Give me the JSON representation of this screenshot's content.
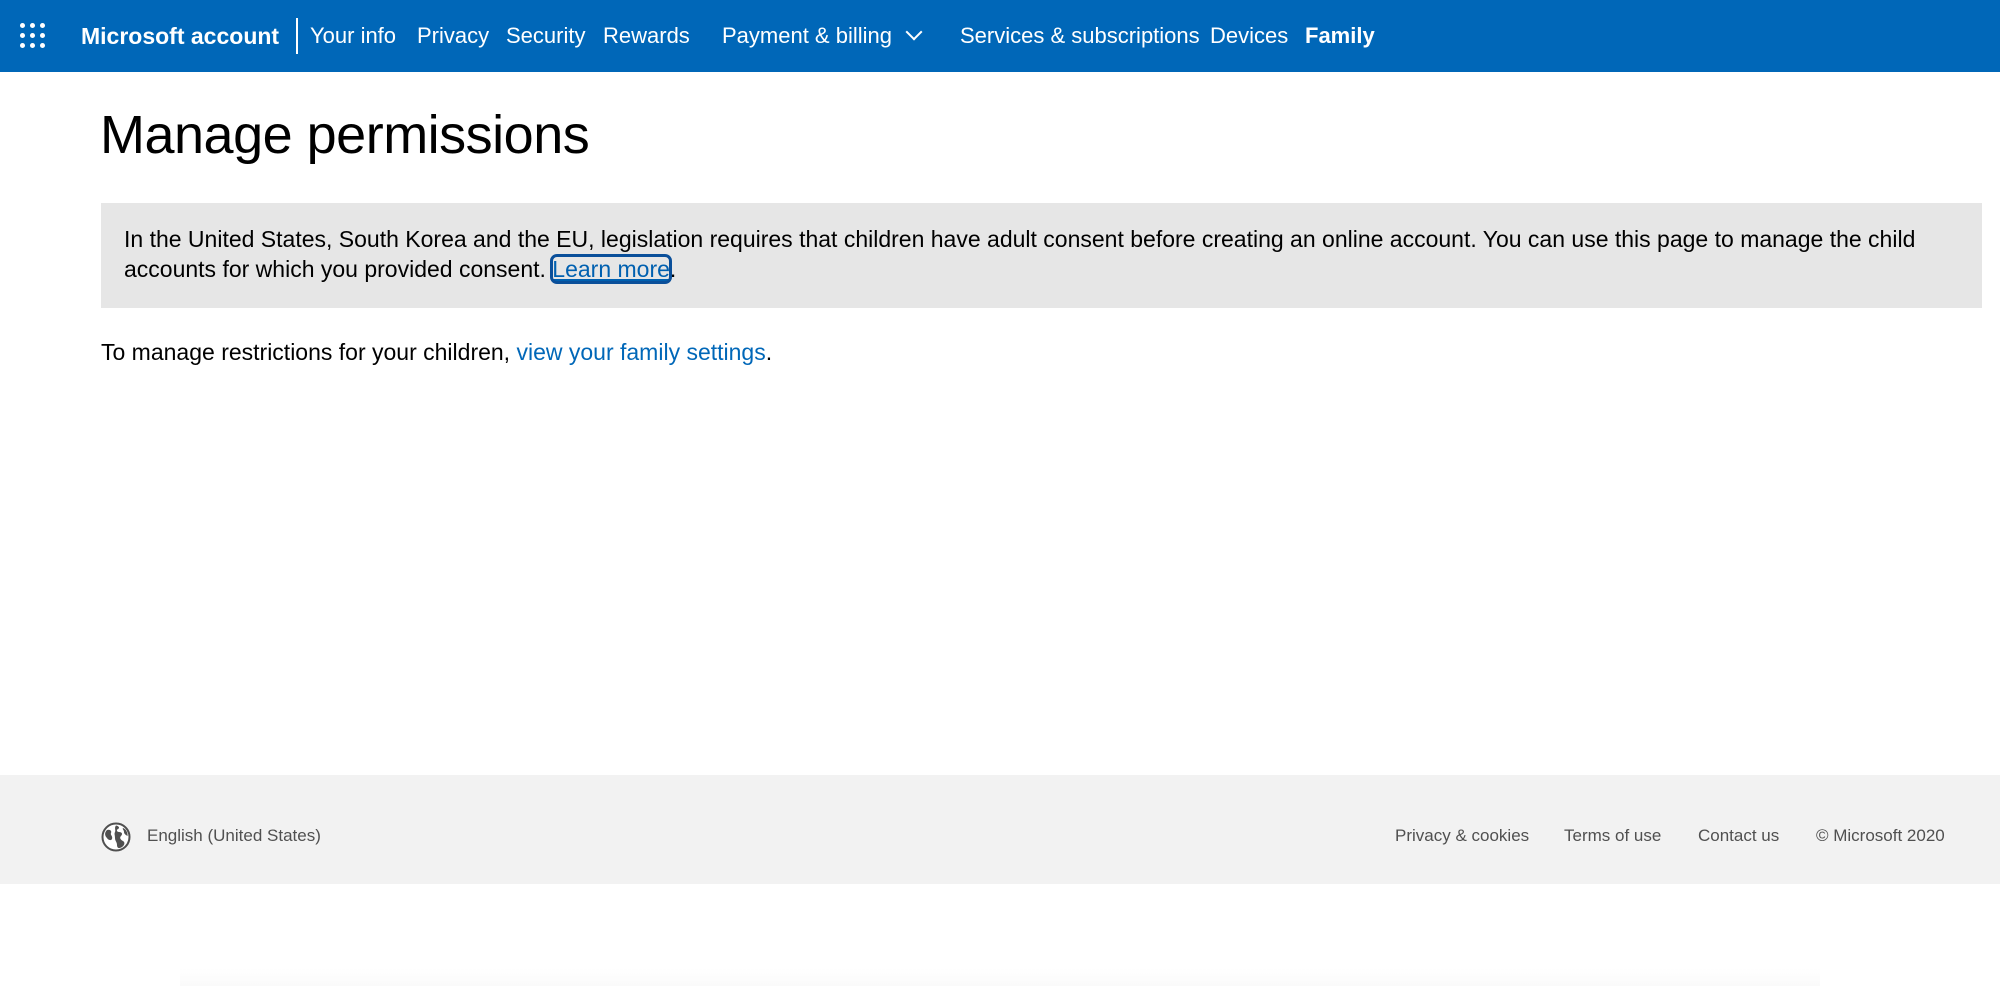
{
  "header": {
    "brand": "Microsoft account",
    "nav": {
      "your_info": "Your info",
      "privacy": "Privacy",
      "security": "Security",
      "rewards": "Rewards",
      "payment_billing": "Payment & billing",
      "services_subscriptions": "Services & subscriptions",
      "devices": "Devices",
      "family": "Family"
    },
    "active_item": "Family"
  },
  "main": {
    "title": "Manage permissions",
    "notice": {
      "text": "In the United States, South Korea and the EU, legislation requires that children have adult consent before creating an online account. You can use this page to manage the child accounts for which you provided consent.",
      "link_label": "Learn more",
      "suffix": "."
    },
    "family": {
      "prefix": "To manage restrictions for your children,",
      "link_label": "view your family settings",
      "suffix": "."
    }
  },
  "footer": {
    "language": "English (United States)",
    "links": {
      "privacy_cookies": "Privacy & cookies",
      "terms": "Terms of use",
      "contact": "Contact us"
    },
    "copyright": "© Microsoft 2020"
  },
  "colors": {
    "brand_blue": "#0067b8",
    "notice_bg": "#e6e6e6",
    "footer_bg": "#f2f2f2",
    "footer_text": "#505050"
  },
  "icons": {
    "app_launcher": "waffle-icon",
    "dropdown": "chevron-down-icon",
    "language": "globe-icon"
  }
}
